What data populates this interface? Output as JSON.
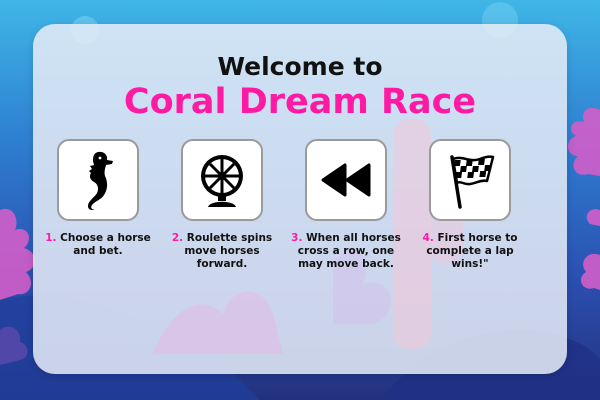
{
  "title": {
    "line1": "Welcome to",
    "line2": "Coral Dream Race"
  },
  "steps": [
    {
      "number": "1.",
      "text": "Choose a horse and bet.",
      "icon": "seahorse-icon"
    },
    {
      "number": "2.",
      "text": "Roulette spins move horses forward.",
      "icon": "roulette-wheel-icon"
    },
    {
      "number": "3.",
      "text": "When all horses cross a row, one may move back.",
      "icon": "rewind-icon"
    },
    {
      "number": "4.",
      "text": "First horse to complete a lap wins!\"",
      "icon": "checkered-flag-icon"
    }
  ],
  "colors": {
    "accent": "#ff1aa3",
    "panel": "#e7ecf7",
    "sea_top": "#3fb6e6",
    "sea_bottom": "#23327f"
  }
}
